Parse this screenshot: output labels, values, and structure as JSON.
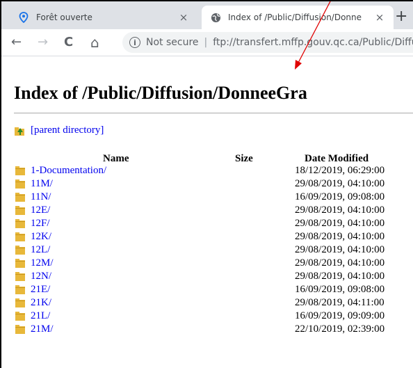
{
  "browser": {
    "tabs": [
      {
        "label": "Forêt ouverte",
        "icon": "location-pin-icon",
        "active": false
      },
      {
        "label": "Index of /Public/Diffusion/Donne",
        "icon": "globe-icon",
        "active": true
      }
    ],
    "close_glyph": "×",
    "new_tab_glyph": "+",
    "nav": {
      "back": "←",
      "forward": "→",
      "reload": "C",
      "home": "⌂"
    },
    "omnibox": {
      "info_glyph": "i",
      "security_text": "Not secure",
      "separator": "|",
      "url": "ftp://transfert.mffp.gouv.qc.ca/Public/Diffu"
    }
  },
  "page": {
    "heading": "Index of /Public/Diffusion/DonneeGra",
    "parent_link": "[parent directory]",
    "columns": {
      "name": "Name",
      "size": "Size",
      "date": "Date Modified"
    },
    "entries": [
      {
        "name": "1-Documentation/",
        "date": "18/12/2019, 06:29:00"
      },
      {
        "name": "11M/",
        "date": "29/08/2019, 04:10:00"
      },
      {
        "name": "11N/",
        "date": "16/09/2019, 09:08:00"
      },
      {
        "name": "12E/",
        "date": "29/08/2019, 04:10:00"
      },
      {
        "name": "12F/",
        "date": "29/08/2019, 04:10:00"
      },
      {
        "name": "12K/",
        "date": "29/08/2019, 04:10:00"
      },
      {
        "name": "12L/",
        "date": "29/08/2019, 04:10:00"
      },
      {
        "name": "12M/",
        "date": "29/08/2019, 04:10:00"
      },
      {
        "name": "12N/",
        "date": "29/08/2019, 04:10:00"
      },
      {
        "name": "21E/",
        "date": "16/09/2019, 09:08:00"
      },
      {
        "name": "21K/",
        "date": "29/08/2019, 04:11:00"
      },
      {
        "name": "21L/",
        "date": "16/09/2019, 09:09:00"
      },
      {
        "name": "21M/",
        "date": "22/10/2019, 02:39:00"
      }
    ]
  },
  "colors": {
    "link": "#0000ee",
    "tabstrip": "#dee1e6",
    "annotation_arrow": "#e00000",
    "folder": "#e8b83a"
  }
}
